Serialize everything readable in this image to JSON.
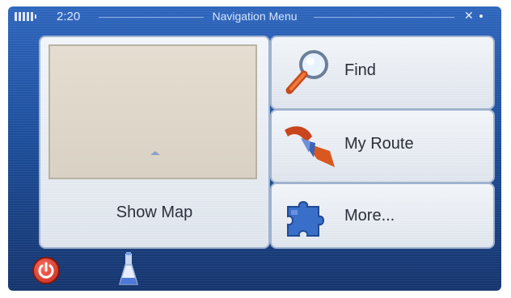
{
  "status_bar": {
    "time": "2:20",
    "title": "Navigation Menu"
  },
  "menu": {
    "show_map_label": "Show Map",
    "find_label": "Find",
    "my_route_label": "My Route",
    "more_label": "More..."
  },
  "icons": {
    "battery": "battery-icon",
    "gps": "gps-satellite-icon",
    "find": "magnifier-icon",
    "route": "route-arrow-icon",
    "more": "puzzle-piece-icon",
    "power": "power-icon",
    "poi": "flask-poi-icon"
  },
  "colors": {
    "screen_top": "#2f66bd",
    "screen_bottom": "#16356e",
    "panel": "#e9edf3",
    "power": "#d23a2a"
  }
}
